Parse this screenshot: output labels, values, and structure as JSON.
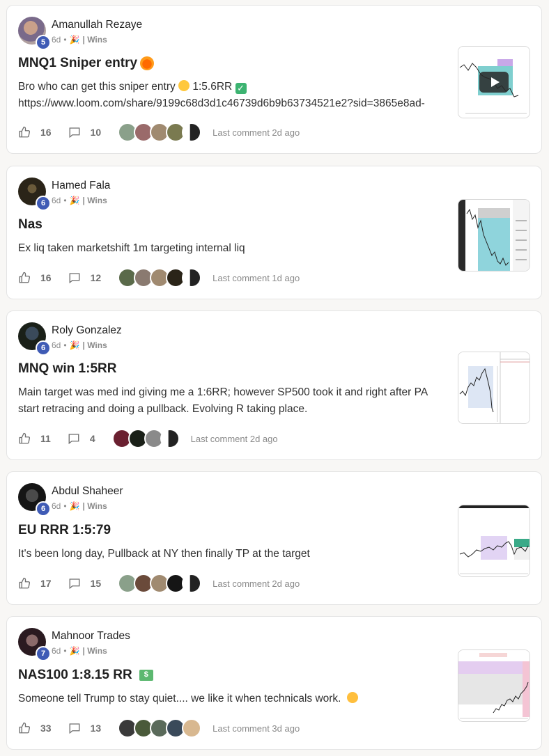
{
  "posts": [
    {
      "author": "Amanullah Rezaye",
      "level": "5",
      "time": "6d",
      "category": "| Wins",
      "title": "MNQ1 Sniper entry",
      "body_line1": "Bro who can get this sniper entry",
      "body_rr": "1:5.6RR",
      "body_line2": "https://www.loom.com/share/9199c68d3d1c46739d6b9b63734521e2?sid=3865e8ad-",
      "likes": "16",
      "comments": "10",
      "last_comment": "Last comment 2d ago"
    },
    {
      "author": "Hamed Fala",
      "level": "6",
      "time": "6d",
      "category": "| Wins",
      "title": "Nas",
      "body": "Ex liq taken marketshift 1m targeting internal liq",
      "likes": "16",
      "comments": "12",
      "last_comment": "Last comment 1d ago"
    },
    {
      "author": "Roly Gonzalez",
      "level": "6",
      "time": "6d",
      "category": "| Wins",
      "title": "MNQ win 1:5RR",
      "body_line1": "Main target was med ind giving me a 1:6RR; however SP500 took it and right after PA",
      "body_line2": "start retracing and doing a pullback. Evolving R taking place.",
      "likes": "11",
      "comments": "4",
      "last_comment": "Last comment 2d ago"
    },
    {
      "author": "Abdul Shaheer",
      "level": "6",
      "time": "6d",
      "category": "| Wins",
      "title": "EU RRR 1:5:79",
      "body": "It's been long day, Pullback at NY then finally TP at the target",
      "likes": "17",
      "comments": "15",
      "last_comment": "Last comment 2d ago"
    },
    {
      "author": "Mahnoor Trades",
      "level": "7",
      "time": "6d",
      "category": "| Wins",
      "title": "NAS100 1:8.15 RR",
      "body": "Someone tell Trump to stay quiet.... we like it when technicals work.",
      "likes": "33",
      "comments": "13",
      "last_comment": "Last comment 3d ago"
    }
  ],
  "colors": {
    "badge": "#3f5bb5",
    "chart_teal": "#7fcfcf",
    "chart_purple": "#c9a8e8",
    "chart_green": "#3aaa88",
    "chart_pink": "#f0b0c8"
  }
}
